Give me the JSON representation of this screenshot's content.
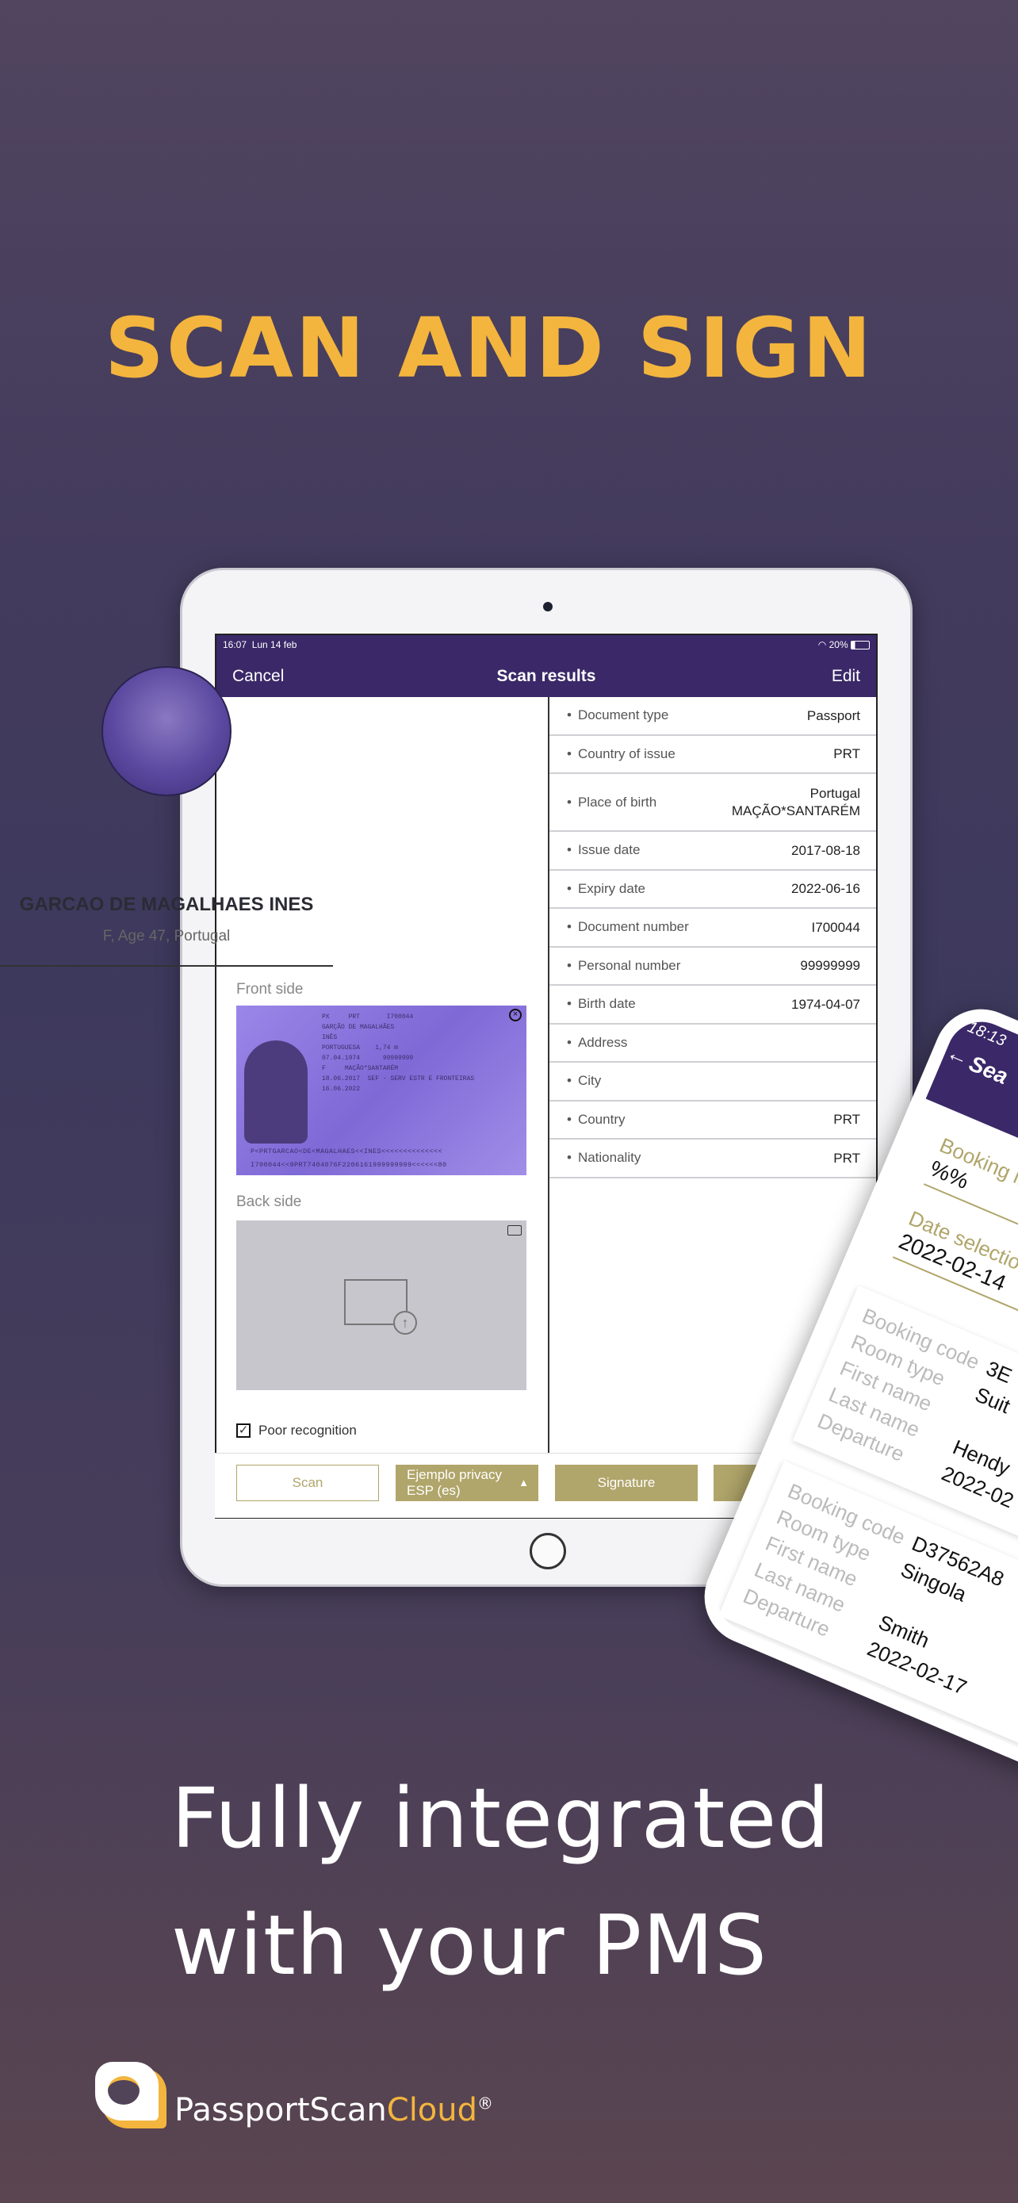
{
  "headline": "SCAN AND SIGN",
  "tagline": {
    "line1": "Fully integrated",
    "line2": "with your PMS"
  },
  "brand": {
    "name_part1": "PassportScan",
    "name_part2": "Cloud",
    "reg": "®",
    "accent": "#f3b53d"
  },
  "colors": {
    "primary": "#3a2868",
    "gold": "#b0a56a",
    "headline": "#f3b53d"
  },
  "tablet": {
    "status": {
      "time": "16:07",
      "date": "Lun 14 feb",
      "battery": "20%"
    },
    "nav": {
      "cancel": "Cancel",
      "title": "Scan results",
      "edit": "Edit"
    },
    "person": {
      "name": "GARCAO DE MAGALHAES INES",
      "details": "F, Age 47, Portugal"
    },
    "front_label": "Front side",
    "back_label": "Back side",
    "passport": {
      "type": "PX",
      "country": "PRT",
      "number": "I700044",
      "surname": "GARÇÃO DE MAGALHÃES",
      "given": "INÊS",
      "nationality": "PORTUGUESA",
      "birth": "07.04.1974",
      "height": "1,74 m",
      "personal": "99999999",
      "sex": "F",
      "place": "MAÇÃO*SANTARÉM",
      "issue": "18.06.2017",
      "authority": "SEF - SERV ESTR E FRONTEIRAS",
      "expiry": "16.06.2022",
      "mrz1": "P<PRTGARCAO<DE<MAGALHAES<<INES<<<<<<<<<<<<<<",
      "mrz2": "I700044<<9PRT7404076F2206161999999999<<<<<<80"
    },
    "poor_recognition": "Poor recognition",
    "poor_checked": true,
    "fields": [
      {
        "label": "Document type",
        "value": "Passport"
      },
      {
        "label": "Country of issue",
        "value": "PRT"
      },
      {
        "label": "Place of birth",
        "value": "Portugal",
        "value2": "MAÇÃO*SANTARÉM"
      },
      {
        "label": "Issue date",
        "value": "2017-08-18"
      },
      {
        "label": "Expiry date",
        "value": "2022-06-16"
      },
      {
        "label": "Document number",
        "value": "I700044"
      },
      {
        "label": "Personal number",
        "value": "99999999"
      },
      {
        "label": "Birth date",
        "value": "1974-04-07"
      },
      {
        "label": "Address",
        "value": ""
      },
      {
        "label": "City",
        "value": ""
      },
      {
        "label": "Country",
        "value": "PRT"
      },
      {
        "label": "Nationality",
        "value": "PRT"
      }
    ],
    "buttons": {
      "scan": "Scan",
      "privacy_line1": "Ejemplo privacy",
      "privacy_line2": "ESP (es)",
      "signature": "Signature"
    }
  },
  "phone": {
    "time": "18:13",
    "title": "Sea",
    "booking_info_label": "Booking info",
    "booking_info_value": "%%",
    "date_label": "Date selection",
    "date_value": "2022-02-14",
    "card_labels": [
      "Booking code",
      "Room type",
      "First name",
      "Last name",
      "Departure"
    ],
    "cards": [
      {
        "values": [
          "3E",
          "Suit",
          "",
          "Hendy",
          "2022-02"
        ]
      },
      {
        "values": [
          "D37562A8",
          "Singola",
          "",
          "Smith",
          "2022-02-17"
        ]
      }
    ]
  }
}
